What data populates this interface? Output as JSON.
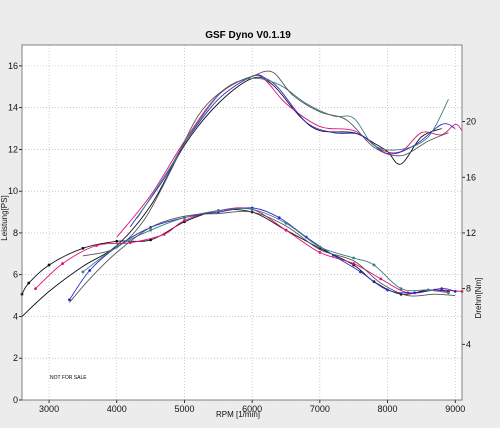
{
  "chart_data": {
    "type": "line",
    "title": "GSF Dyno V0.1.19",
    "xlabel": "RPM [1/min]",
    "ylabel_left": "Leistung[PS]",
    "ylabel_right": "Drehm[Nm]",
    "annotation": "NOT FOR SALE",
    "xlim": [
      2600,
      9100
    ],
    "ylim_left": [
      0,
      17
    ],
    "ylim_right": [
      0,
      25.5
    ],
    "x_ticks": [
      3000,
      4000,
      5000,
      6000,
      7000,
      8000,
      9000
    ],
    "y_left_ticks": [
      0,
      2,
      4,
      6,
      8,
      10,
      12,
      14,
      16
    ],
    "y_right_ticks": [
      4,
      8,
      12,
      16,
      20
    ],
    "grid": true,
    "colors": {
      "background": "#ffffff",
      "frame": "#ececec",
      "grid": "#aaaaaa",
      "black": "#111111",
      "magenta": "#e0107a",
      "blue": "#2a2ad0",
      "teal": "#3a7f86",
      "gray": "#555555"
    },
    "power_series": [
      {
        "color": "#111111",
        "points": [
          [
            2600,
            4.0
          ],
          [
            3000,
            5.2
          ],
          [
            3500,
            6.4
          ],
          [
            4000,
            7.4
          ],
          [
            4500,
            9.3
          ],
          [
            5000,
            12.2
          ],
          [
            5500,
            14.2
          ],
          [
            6000,
            15.4
          ],
          [
            6300,
            15.1
          ],
          [
            6700,
            13.6
          ],
          [
            7000,
            12.9
          ],
          [
            7500,
            12.8
          ],
          [
            7800,
            12.3
          ],
          [
            8000,
            11.9
          ],
          [
            8200,
            11.3
          ],
          [
            8500,
            12.6
          ],
          [
            8800,
            13.0
          ]
        ]
      },
      {
        "color": "#e0107a",
        "points": [
          [
            4000,
            7.8
          ],
          [
            4500,
            9.8
          ],
          [
            5000,
            12.4
          ],
          [
            5500,
            14.6
          ],
          [
            6000,
            15.5
          ],
          [
            6200,
            15.3
          ],
          [
            6500,
            14.2
          ],
          [
            7000,
            13.1
          ],
          [
            7500,
            12.9
          ],
          [
            7900,
            12.0
          ],
          [
            8200,
            11.9
          ],
          [
            8500,
            12.8
          ],
          [
            8800,
            12.7
          ],
          [
            9000,
            13.2
          ],
          [
            9100,
            12.9
          ]
        ]
      },
      {
        "color": "#2a2ad0",
        "points": [
          [
            4200,
            8.3
          ],
          [
            4700,
            10.6
          ],
          [
            5000,
            12.3
          ],
          [
            5500,
            14.4
          ],
          [
            6000,
            15.5
          ],
          [
            6200,
            15.4
          ],
          [
            6400,
            14.9
          ],
          [
            6800,
            13.3
          ],
          [
            7200,
            12.8
          ],
          [
            7600,
            12.7
          ],
          [
            8000,
            11.8
          ],
          [
            8400,
            12.2
          ],
          [
            8800,
            13.2
          ],
          [
            9000,
            13.0
          ]
        ]
      },
      {
        "color": "#3a7f86",
        "points": [
          [
            4300,
            8.7
          ],
          [
            4800,
            11.2
          ],
          [
            5200,
            13.3
          ],
          [
            5600,
            14.9
          ],
          [
            6000,
            15.4
          ],
          [
            6400,
            15.1
          ],
          [
            6800,
            14.2
          ],
          [
            7200,
            13.6
          ],
          [
            7500,
            13.5
          ],
          [
            7800,
            12.2
          ],
          [
            8200,
            12.0
          ],
          [
            8600,
            12.6
          ],
          [
            8900,
            14.4
          ]
        ]
      },
      {
        "color": "#555555",
        "points": [
          [
            3500,
            6.9
          ],
          [
            4000,
            7.3
          ],
          [
            4400,
            8.6
          ],
          [
            4800,
            11.0
          ],
          [
            5200,
            13.6
          ],
          [
            5600,
            14.9
          ],
          [
            6000,
            15.5
          ],
          [
            6300,
            15.7
          ],
          [
            6600,
            14.6
          ],
          [
            7000,
            13.8
          ],
          [
            7400,
            13.4
          ],
          [
            7800,
            12.1
          ],
          [
            8200,
            11.7
          ],
          [
            8600,
            12.4
          ],
          [
            8900,
            12.8
          ]
        ]
      }
    ],
    "torque_series": [
      {
        "color": "#111111",
        "markers": true,
        "points": [
          [
            2600,
            7.6
          ],
          [
            2700,
            8.4
          ],
          [
            3000,
            9.7
          ],
          [
            3500,
            10.9
          ],
          [
            4000,
            11.4
          ],
          [
            4500,
            11.5
          ],
          [
            5000,
            12.8
          ],
          [
            5500,
            13.6
          ],
          [
            6000,
            13.5
          ],
          [
            6500,
            12.2
          ],
          [
            7000,
            10.9
          ],
          [
            7500,
            9.7
          ],
          [
            7800,
            8.5
          ],
          [
            8200,
            7.6
          ],
          [
            8600,
            7.9
          ],
          [
            8900,
            7.8
          ]
        ]
      },
      {
        "color": "#e0107a",
        "markers": true,
        "points": [
          [
            2800,
            8.0
          ],
          [
            3200,
            9.8
          ],
          [
            3700,
            11.1
          ],
          [
            4200,
            11.3
          ],
          [
            4700,
            11.9
          ],
          [
            5000,
            12.9
          ],
          [
            5500,
            13.6
          ],
          [
            6000,
            13.7
          ],
          [
            6500,
            12.2
          ],
          [
            7000,
            10.6
          ],
          [
            7500,
            9.8
          ],
          [
            7900,
            8.7
          ],
          [
            8300,
            7.7
          ],
          [
            8700,
            7.9
          ],
          [
            9100,
            7.8
          ]
        ]
      },
      {
        "color": "#2a2ad0",
        "markers": true,
        "points": [
          [
            3300,
            7.2
          ],
          [
            3600,
            9.3
          ],
          [
            4000,
            11.0
          ],
          [
            4500,
            12.4
          ],
          [
            5000,
            13.1
          ],
          [
            5500,
            13.5
          ],
          [
            6000,
            13.8
          ],
          [
            6400,
            13.1
          ],
          [
            6800,
            11.7
          ],
          [
            7200,
            10.4
          ],
          [
            7600,
            9.2
          ],
          [
            8000,
            7.9
          ],
          [
            8400,
            7.7
          ],
          [
            8800,
            8.0
          ],
          [
            9000,
            7.8
          ]
        ]
      },
      {
        "color": "#3a7f86",
        "markers": true,
        "points": [
          [
            3500,
            9.2
          ],
          [
            4000,
            11.0
          ],
          [
            4500,
            12.2
          ],
          [
            5000,
            13.1
          ],
          [
            5500,
            13.6
          ],
          [
            6000,
            13.7
          ],
          [
            6500,
            12.7
          ],
          [
            7000,
            11.0
          ],
          [
            7500,
            10.2
          ],
          [
            7800,
            9.7
          ],
          [
            8200,
            8.0
          ],
          [
            8600,
            7.9
          ],
          [
            8900,
            7.7
          ]
        ]
      },
      {
        "color": "#555555",
        "markers": false,
        "points": [
          [
            3300,
            7.0
          ],
          [
            3600,
            8.7
          ],
          [
            4000,
            10.6
          ],
          [
            4500,
            12.4
          ],
          [
            5000,
            13.2
          ],
          [
            5500,
            13.4
          ],
          [
            6000,
            13.5
          ],
          [
            6500,
            12.5
          ],
          [
            7000,
            10.8
          ],
          [
            7500,
            10.0
          ],
          [
            7900,
            8.4
          ],
          [
            8300,
            7.5
          ],
          [
            8700,
            7.6
          ],
          [
            9000,
            7.5
          ]
        ]
      }
    ]
  }
}
